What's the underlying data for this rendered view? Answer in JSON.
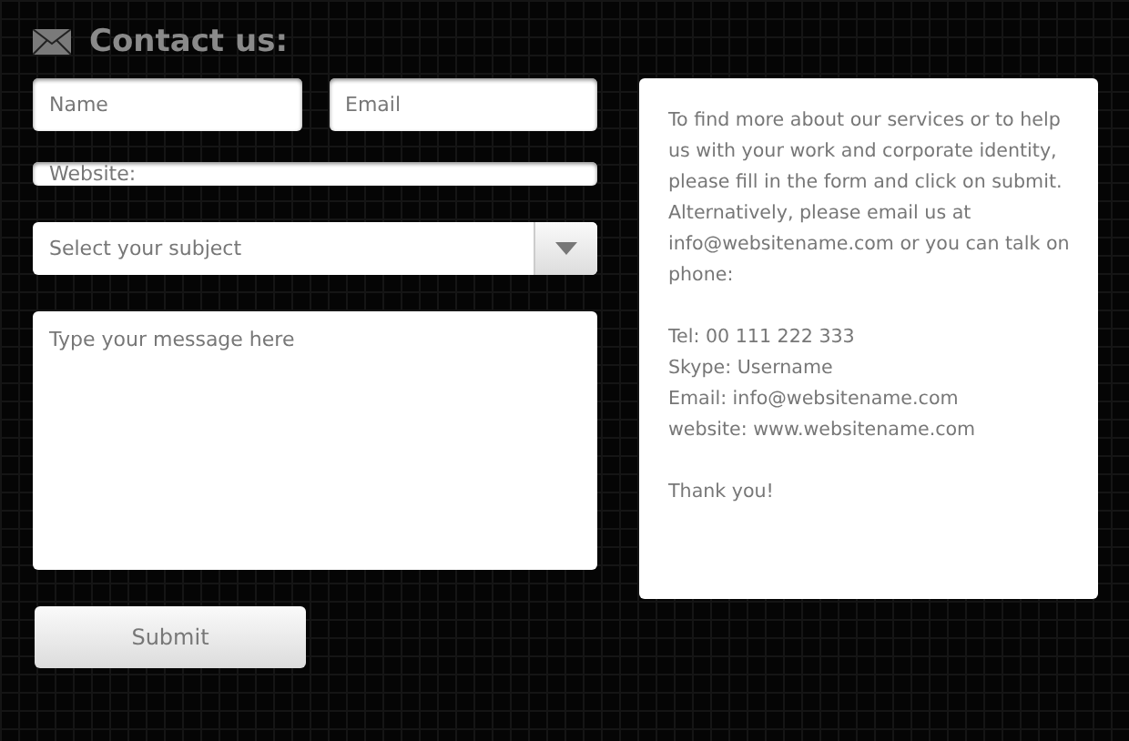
{
  "heading": "Contact us:",
  "fields": {
    "name": {
      "placeholder": "Name"
    },
    "email": {
      "placeholder": "Email"
    },
    "website": {
      "placeholder": "Website:"
    }
  },
  "subject": {
    "value": "Select your subject"
  },
  "message": {
    "placeholder": "Type your message here"
  },
  "submit": "Submit",
  "info": {
    "paragraphs": [
      [
        "To find more about our services or to help us with your work and corporate identity, please fill in the form and click on submit. Alternatively, please email us at info@websitename.com or you can talk on phone:"
      ],
      [
        "Tel: 00 111 222 333",
        "Skype: Username",
        "Email: info@websitename.com",
        "website: www.websitename.com"
      ],
      [
        "Thank you!"
      ]
    ]
  }
}
